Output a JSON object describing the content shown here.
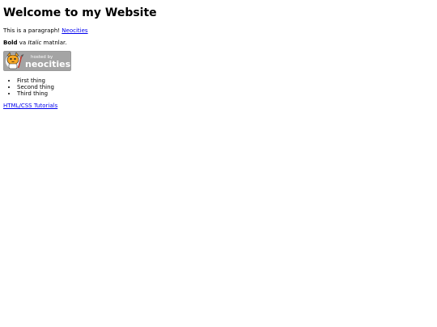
{
  "page": {
    "heading": "Welcome to my Website",
    "paragraph": {
      "text": "This is a paragraph! ",
      "link": "Neocities"
    },
    "formatting": {
      "bold": "Bold",
      "middle": " va ",
      "italic": "Italic",
      "end": " matnlar."
    },
    "badge": {
      "line1": "hosted by",
      "line2": "neocities",
      "icon": "neocities-cat-logo"
    },
    "list": [
      "First thing",
      "Second thing",
      "Third thing"
    ],
    "tutorials_link": "HTML/CSS Tutorials"
  }
}
